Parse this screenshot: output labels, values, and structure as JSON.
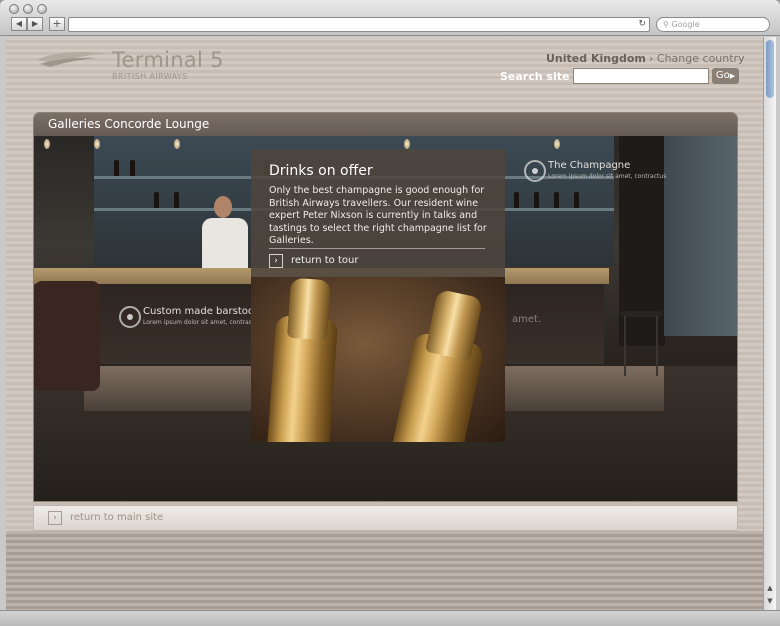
{
  "browser": {
    "search_placeholder": "Google",
    "reload_icon": "reload-icon",
    "back_icon": "back-arrow-icon",
    "forward_icon": "forward-arrow-icon",
    "add_icon": "plus-icon"
  },
  "header": {
    "brand_title": "Terminal 5",
    "brand_subtitle": "BRITISH AIRWAYS",
    "country": "United Kingdom",
    "change_country": "Change country",
    "search_label": "Search site",
    "search_value": "",
    "go_label": "Go"
  },
  "gallery": {
    "title": "Galleries Concorde Lounge",
    "hotspots": [
      {
        "title": "Custom made barstool",
        "desc": "Lorem ipsum dolor sit amet, contractus"
      },
      {
        "title": "The Champagne",
        "desc": "Lorem ipsum dolor sit amet, contractus"
      }
    ],
    "panel": {
      "title": "Drinks on offer",
      "text": "Only the best champagne is good enough for British Airways travellers. Our resident wine expert Peter Nixson is currently in talks and tastings to select the right champagne list for Galleries.",
      "return_label": "return to tour"
    },
    "hidden_text_fragment": "amet."
  },
  "footer": {
    "return_main_label": "return to main site"
  },
  "colors": {
    "page_bg": "#d2c9c2",
    "title_bar": "#6f635a",
    "brand_text": "#a09589",
    "panel_bg": "#4e463e"
  }
}
